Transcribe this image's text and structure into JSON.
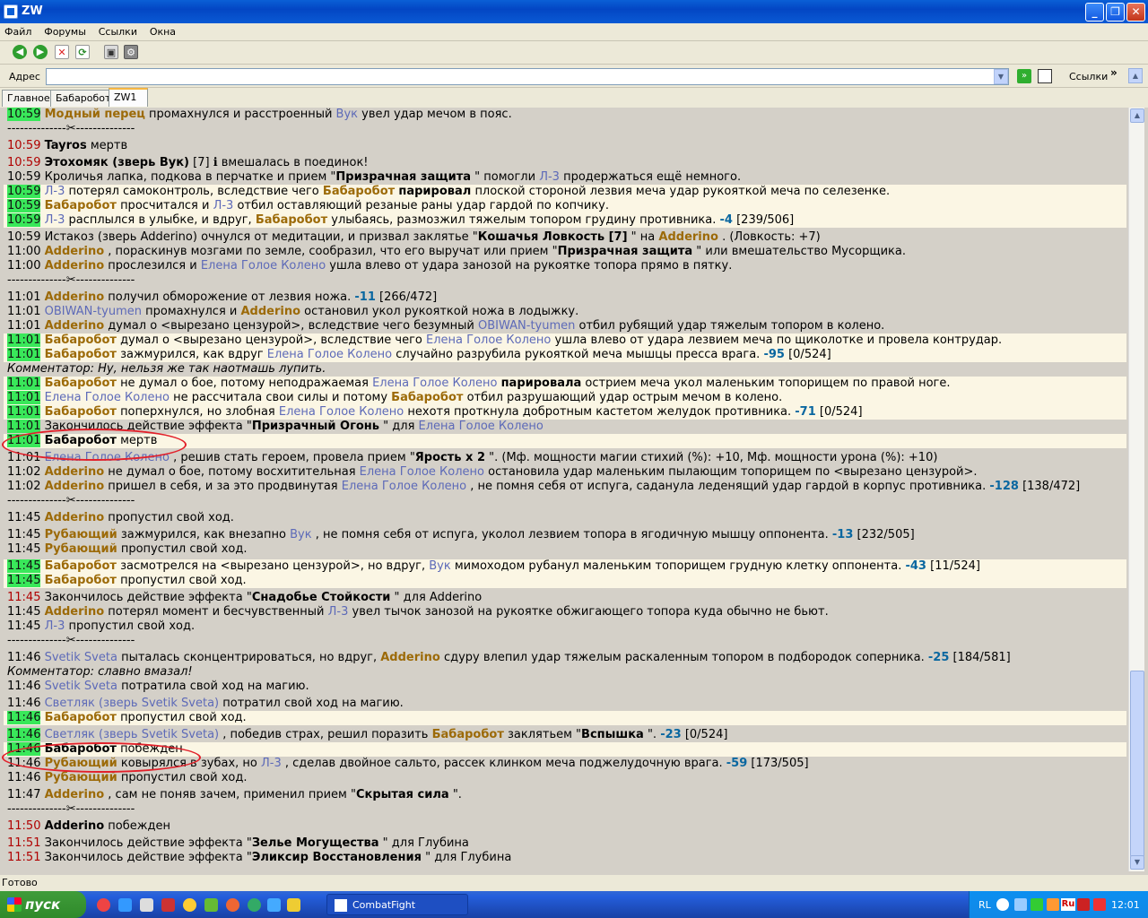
{
  "window": {
    "title": "ZW",
    "min": "_",
    "max": "❐",
    "close": "✕"
  },
  "menu": [
    "Файл",
    "Форумы",
    "Ссылки",
    "Окна"
  ],
  "address": {
    "label": "Адрес",
    "value": "",
    "links_label": "Ссылки",
    "more": "»"
  },
  "tabs": [
    {
      "label": "Главное",
      "active": false
    },
    {
      "label": "Бабаробот",
      "active": false
    },
    {
      "label": "ZW1",
      "active": true
    }
  ],
  "log": [
    {
      "kind": "line",
      "t": "10:59",
      "tc": "green",
      "hl": false,
      "p": [
        [
          "nm",
          "Модный перец"
        ],
        [
          "",
          "промахнулся и расстроенный "
        ],
        [
          "nb",
          "Вук"
        ],
        [
          "",
          "увел удар мечом в пояс."
        ]
      ]
    },
    {
      "kind": "sep"
    },
    {
      "kind": "space"
    },
    {
      "kind": "line",
      "t": "10:59",
      "tc": "red",
      "hl": false,
      "p": [
        [
          "b",
          "Tayros"
        ],
        [
          "",
          "мертв"
        ]
      ]
    },
    {
      "kind": "space"
    },
    {
      "kind": "line",
      "t": "10:59",
      "tc": "red",
      "hl": false,
      "p": [
        [
          "b",
          "Этохомяк (зверь Вук)"
        ],
        [
          "",
          "[7] ℹ вмешалась в поединок!"
        ]
      ]
    },
    {
      "kind": "line",
      "t": "10:59",
      "tc": "",
      "hl": false,
      "p": [
        [
          "",
          "Кроличья лапка, подкова в перчатке и прием \""
        ],
        [
          "b",
          "Призрачная защита"
        ],
        [
          "",
          "\" помогли "
        ],
        [
          "nb",
          "Л-3"
        ],
        [
          "",
          "продержаться ещё немного."
        ]
      ]
    },
    {
      "kind": "line",
      "t": "10:59",
      "tc": "green",
      "hl": true,
      "p": [
        [
          "nb",
          "Л-3"
        ],
        [
          "",
          "потерял самоконтроль, вследствие чего "
        ],
        [
          "nm",
          "Бабаробот"
        ],
        [
          "b",
          "парировал"
        ],
        [
          "",
          "плоской стороной лезвия меча удар рукояткой меча по селезенке."
        ]
      ]
    },
    {
      "kind": "line",
      "t": "10:59",
      "tc": "green",
      "hl": true,
      "p": [
        [
          "nm",
          "Бабаробот"
        ],
        [
          "",
          "просчитался и "
        ],
        [
          "nb",
          "Л-3"
        ],
        [
          "",
          "отбил оставляющий резаные раны удар гардой по копчику."
        ]
      ]
    },
    {
      "kind": "line",
      "t": "10:59",
      "tc": "green",
      "hl": true,
      "p": [
        [
          "nb",
          "Л-3"
        ],
        [
          "",
          "расплылся в улыбке, и вдруг, "
        ],
        [
          "nm",
          "Бабаробот"
        ],
        [
          "",
          "улыбаясь, размозжил тяжелым топором грудину противника. "
        ],
        [
          "dmg",
          "-4"
        ],
        [
          "",
          "[239/506]"
        ]
      ]
    },
    {
      "kind": "space"
    },
    {
      "kind": "line",
      "t": "10:59",
      "tc": "",
      "hl": false,
      "p": [
        [
          "",
          "Истакоз (зверь Adderino) очнулся от медитации, и призвал заклятье \""
        ],
        [
          "b",
          "Кошачья Ловкость [7]"
        ],
        [
          "",
          "\" на "
        ],
        [
          "nm",
          "Adderino"
        ],
        [
          "",
          ". (Ловкость: +7)"
        ]
      ]
    },
    {
      "kind": "line",
      "t": "11:00",
      "tc": "",
      "hl": false,
      "p": [
        [
          "nm",
          "Adderino"
        ],
        [
          "",
          ", пораскинув мозгами по земле, сообразил, что его выручат или прием \""
        ],
        [
          "b",
          "Призрачная защита"
        ],
        [
          "",
          "\" или вмешательство Мусорщика."
        ]
      ]
    },
    {
      "kind": "line",
      "t": "11:00",
      "tc": "",
      "hl": false,
      "p": [
        [
          "nm",
          "Adderino"
        ],
        [
          "",
          "прослезился и "
        ],
        [
          "nb",
          "Елена Голое Колено"
        ],
        [
          "",
          "ушла влево от удара занозой на рукоятке топора прямо в пятку."
        ]
      ]
    },
    {
      "kind": "sep"
    },
    {
      "kind": "space"
    },
    {
      "kind": "line",
      "t": "11:01",
      "tc": "",
      "hl": false,
      "p": [
        [
          "nm",
          "Adderino"
        ],
        [
          "",
          "получил обморожение от лезвия ножа. "
        ],
        [
          "dmg",
          "-11"
        ],
        [
          "",
          "[266/472]"
        ]
      ]
    },
    {
      "kind": "line",
      "t": "11:01",
      "tc": "",
      "hl": false,
      "p": [
        [
          "nb",
          "OBIWAN-tyumen"
        ],
        [
          "",
          "промахнулся и "
        ],
        [
          "nm",
          "Adderino"
        ],
        [
          "",
          "остановил укол рукояткой ножа в лодыжку."
        ]
      ]
    },
    {
      "kind": "line",
      "t": "11:01",
      "tc": "",
      "hl": false,
      "p": [
        [
          "nm",
          "Adderino"
        ],
        [
          "",
          "думал о <вырезано цензурой>, вследствие чего безумный "
        ],
        [
          "nb",
          "OBIWAN-tyumen"
        ],
        [
          "",
          "отбил рубящий удар тяжелым топором в колено."
        ]
      ]
    },
    {
      "kind": "line",
      "t": "11:01",
      "tc": "green",
      "hl": true,
      "p": [
        [
          "nm",
          "Бабаробот"
        ],
        [
          "",
          "думал о <вырезано цензурой>, вследствие чего "
        ],
        [
          "nb",
          "Елена Голое Колено"
        ],
        [
          "",
          "ушла влево от удара лезвием меча по щиколотке и провела контрудар."
        ]
      ]
    },
    {
      "kind": "line",
      "t": "11:01",
      "tc": "green",
      "hl": true,
      "p": [
        [
          "nm",
          "Бабаробот"
        ],
        [
          "",
          "зажмурился, как вдруг "
        ],
        [
          "nb",
          "Елена Голое Колено"
        ],
        [
          "",
          "случайно разрубила рукояткой меча мышцы пресса врага. "
        ],
        [
          "dmg",
          "-95"
        ],
        [
          "",
          "[0/524]"
        ]
      ]
    },
    {
      "kind": "comment",
      "text": "Комментатор: Ну, нельзя же так наотмашь лупить."
    },
    {
      "kind": "line",
      "t": "11:01",
      "tc": "green",
      "hl": true,
      "p": [
        [
          "nm",
          "Бабаробот"
        ],
        [
          "",
          "не думал о бое, потому неподражаемая "
        ],
        [
          "nb",
          "Елена Голое Колено"
        ],
        [
          "b",
          "парировала"
        ],
        [
          "",
          "острием меча укол маленьким топорищем по правой ноге."
        ]
      ]
    },
    {
      "kind": "line",
      "t": "11:01",
      "tc": "green",
      "hl": true,
      "p": [
        [
          "nb",
          "Елена Голое Колено"
        ],
        [
          "",
          "не рассчитала свои силы и потому "
        ],
        [
          "nm",
          "Бабаробот"
        ],
        [
          "",
          "отбил разрушающий удар острым мечом в колено."
        ]
      ]
    },
    {
      "kind": "line",
      "t": "11:01",
      "tc": "green",
      "hl": true,
      "p": [
        [
          "nm",
          "Бабаробот"
        ],
        [
          "",
          "поперхнулся, но злобная "
        ],
        [
          "nb",
          "Елена Голое Колено"
        ],
        [
          "",
          "нехотя проткнула добротным кастетом желудок противника. "
        ],
        [
          "dmg",
          "-71"
        ],
        [
          "",
          "[0/524]"
        ]
      ]
    },
    {
      "kind": "line",
      "t": "11:01",
      "tc": "green",
      "hl": false,
      "p": [
        [
          "",
          "Закончилось действие эффекта \""
        ],
        [
          "b",
          "Призрачный Огонь"
        ],
        [
          "",
          "\" для "
        ],
        [
          "nb",
          "Елена Голое Колено"
        ]
      ]
    },
    {
      "kind": "line",
      "t": "11:01",
      "tc": "green",
      "hl": true,
      "p": [
        [
          "b",
          "Бабаробот"
        ],
        [
          "",
          "мертв"
        ]
      ]
    },
    {
      "kind": "space"
    },
    {
      "kind": "line",
      "t": "11:01",
      "tc": "",
      "hl": false,
      "p": [
        [
          "nb",
          "Елена Голое Колено"
        ],
        [
          "",
          ", решив стать героем, провела прием \""
        ],
        [
          "b",
          "Ярость x 2"
        ],
        [
          "",
          "\". (Мф. мощности магии стихий (%): +10, Мф. мощности урона (%): +10)"
        ]
      ]
    },
    {
      "kind": "line",
      "t": "11:02",
      "tc": "",
      "hl": false,
      "p": [
        [
          "nm",
          "Adderino"
        ],
        [
          "",
          "не думал о бое, потому восхитительная "
        ],
        [
          "nb",
          "Елена Голое Колено"
        ],
        [
          "",
          "остановила удар маленьким пылающим топорищем по <вырезано цензурой>."
        ]
      ]
    },
    {
      "kind": "line",
      "t": "11:02",
      "tc": "",
      "hl": false,
      "p": [
        [
          "nm",
          "Adderino"
        ],
        [
          "",
          "пришел в себя, и за это продвинутая "
        ],
        [
          "nb",
          "Елена Голое Колено"
        ],
        [
          "",
          ", не помня себя от испуга, саданула леденящий удар гардой в корпус противника. "
        ],
        [
          "dmg",
          "-128"
        ],
        [
          "",
          "[138/472]"
        ]
      ]
    },
    {
      "kind": "sep"
    },
    {
      "kind": "space"
    },
    {
      "kind": "line",
      "t": "11:45",
      "tc": "",
      "hl": false,
      "p": [
        [
          "nm",
          "Adderino"
        ],
        [
          "",
          "пропустил свой ход."
        ]
      ]
    },
    {
      "kind": "space"
    },
    {
      "kind": "line",
      "t": "11:45",
      "tc": "",
      "hl": false,
      "p": [
        [
          "nm",
          "Рубающий"
        ],
        [
          "",
          "зажмурился, как внезапно "
        ],
        [
          "nb",
          "Вук"
        ],
        [
          "",
          ", не помня себя от испуга, уколол лезвием топора в ягодичную мышцу оппонента. "
        ],
        [
          "dmg",
          "-13"
        ],
        [
          "",
          "[232/505]"
        ]
      ]
    },
    {
      "kind": "line",
      "t": "11:45",
      "tc": "",
      "hl": false,
      "p": [
        [
          "nm",
          "Рубающий"
        ],
        [
          "",
          "пропустил свой ход."
        ]
      ]
    },
    {
      "kind": "space"
    },
    {
      "kind": "line",
      "t": "11:45",
      "tc": "green",
      "hl": true,
      "p": [
        [
          "nm",
          "Бабаробот"
        ],
        [
          "",
          "засмотрелся на <вырезано цензурой>, но вдруг, "
        ],
        [
          "nb",
          "Вук"
        ],
        [
          "",
          "мимоходом рубанул маленьким топорищем грудную клетку оппонента. "
        ],
        [
          "dmg",
          "-43"
        ],
        [
          "",
          "[11/524]"
        ]
      ]
    },
    {
      "kind": "line",
      "t": "11:45",
      "tc": "green",
      "hl": true,
      "p": [
        [
          "nm",
          "Бабаробот"
        ],
        [
          "",
          "пропустил свой ход."
        ]
      ]
    },
    {
      "kind": "space"
    },
    {
      "kind": "line",
      "t": "11:45",
      "tc": "red",
      "hl": false,
      "p": [
        [
          "",
          "Закончилось действие эффекта \""
        ],
        [
          "b",
          "Снадобье Стойкости"
        ],
        [
          "",
          "\" для Adderino"
        ]
      ]
    },
    {
      "kind": "line",
      "t": "11:45",
      "tc": "",
      "hl": false,
      "p": [
        [
          "nm",
          "Adderino"
        ],
        [
          "",
          "потерял момент и бесчувственный "
        ],
        [
          "nb",
          "Л-3"
        ],
        [
          "",
          "увел тычок занозой на рукоятке обжигающего топора куда обычно не бьют."
        ]
      ]
    },
    {
      "kind": "line",
      "t": "11:45",
      "tc": "",
      "hl": false,
      "p": [
        [
          "nb",
          "Л-3"
        ],
        [
          "",
          "пропустил свой ход."
        ]
      ]
    },
    {
      "kind": "sep"
    },
    {
      "kind": "space"
    },
    {
      "kind": "line",
      "t": "11:46",
      "tc": "",
      "hl": false,
      "p": [
        [
          "nb",
          "Svetik Sveta"
        ],
        [
          "",
          "пыталась сконцентрироваться, но вдруг, "
        ],
        [
          "nm",
          "Adderino"
        ],
        [
          "",
          "сдуру влепил удар тяжелым раскаленным топором в подбородок соперника. "
        ],
        [
          "dmg",
          "-25"
        ],
        [
          "",
          "[184/581]"
        ]
      ]
    },
    {
      "kind": "comment",
      "text": "Комментатор: славно вмазал!"
    },
    {
      "kind": "line",
      "t": "11:46",
      "tc": "",
      "hl": false,
      "p": [
        [
          "nb",
          "Svetik Sveta"
        ],
        [
          "",
          "потратила свой ход на магию."
        ]
      ]
    },
    {
      "kind": "space"
    },
    {
      "kind": "line",
      "t": "11:46",
      "tc": "",
      "hl": false,
      "p": [
        [
          "nb",
          "Светляк (зверь Svetik Sveta)"
        ],
        [
          "",
          "потратил свой ход на магию."
        ]
      ]
    },
    {
      "kind": "line",
      "t": "11:46",
      "tc": "green",
      "hl": true,
      "p": [
        [
          "nm",
          "Бабаробот"
        ],
        [
          "",
          "пропустил свой ход."
        ]
      ]
    },
    {
      "kind": "space"
    },
    {
      "kind": "line",
      "t": "11:46",
      "tc": "green",
      "hl": false,
      "p": [
        [
          "nb",
          "Светляк (зверь Svetik Sveta)"
        ],
        [
          "",
          ", победив страх, решил поразить "
        ],
        [
          "nm",
          "Бабаробот"
        ],
        [
          "",
          "заклятьем \""
        ],
        [
          "b",
          "Вспышка"
        ],
        [
          "",
          "\". "
        ],
        [
          "dmg",
          "-23"
        ],
        [
          "",
          "[0/524]"
        ]
      ]
    },
    {
      "kind": "line",
      "t": "11:46",
      "tc": "green",
      "hl": true,
      "p": [
        [
          "b",
          "Бабаробот"
        ],
        [
          "",
          "побежден"
        ]
      ]
    },
    {
      "kind": "line",
      "t": "11:46",
      "tc": "",
      "hl": false,
      "p": [
        [
          "nm",
          "Рубающий"
        ],
        [
          "",
          "ковырялся в зубах, но "
        ],
        [
          "nb",
          "Л-3"
        ],
        [
          "",
          ", сделав двойное сальто, рассек клинком меча поджелудочную врага. "
        ],
        [
          "dmg",
          "-59"
        ],
        [
          "",
          "[173/505]"
        ]
      ]
    },
    {
      "kind": "line",
      "t": "11:46",
      "tc": "",
      "hl": false,
      "p": [
        [
          "nm",
          "Рубающий"
        ],
        [
          "",
          "пропустил свой ход."
        ]
      ]
    },
    {
      "kind": "space"
    },
    {
      "kind": "line",
      "t": "11:47",
      "tc": "",
      "hl": false,
      "p": [
        [
          "nm",
          "Adderino"
        ],
        [
          "",
          ", сам не поняв зачем, применил прием \""
        ],
        [
          "b",
          "Скрытая сила"
        ],
        [
          "",
          "\"."
        ]
      ]
    },
    {
      "kind": "sep"
    },
    {
      "kind": "space"
    },
    {
      "kind": "line",
      "t": "11:50",
      "tc": "red",
      "hl": false,
      "p": [
        [
          "b",
          "Adderino"
        ],
        [
          "",
          "побежден"
        ]
      ]
    },
    {
      "kind": "space"
    },
    {
      "kind": "line",
      "t": "11:51",
      "tc": "red",
      "hl": false,
      "p": [
        [
          "",
          "Закончилось действие эффекта \""
        ],
        [
          "b",
          "Зелье Могущества"
        ],
        [
          "",
          "\" для Глубина"
        ]
      ]
    },
    {
      "kind": "line",
      "t": "11:51",
      "tc": "red",
      "hl": false,
      "p": [
        [
          "",
          "Закончилось действие эффекта \""
        ],
        [
          "b",
          "Эликсир Восстановления"
        ],
        [
          "",
          "\" для Глубина"
        ]
      ]
    }
  ],
  "separator_glyph": "✂",
  "status": "Готово",
  "taskbar": {
    "start": "пуск",
    "app": "CombatFight",
    "lang": "RL",
    "tray_lang": "Ru",
    "clock": "12:01"
  }
}
